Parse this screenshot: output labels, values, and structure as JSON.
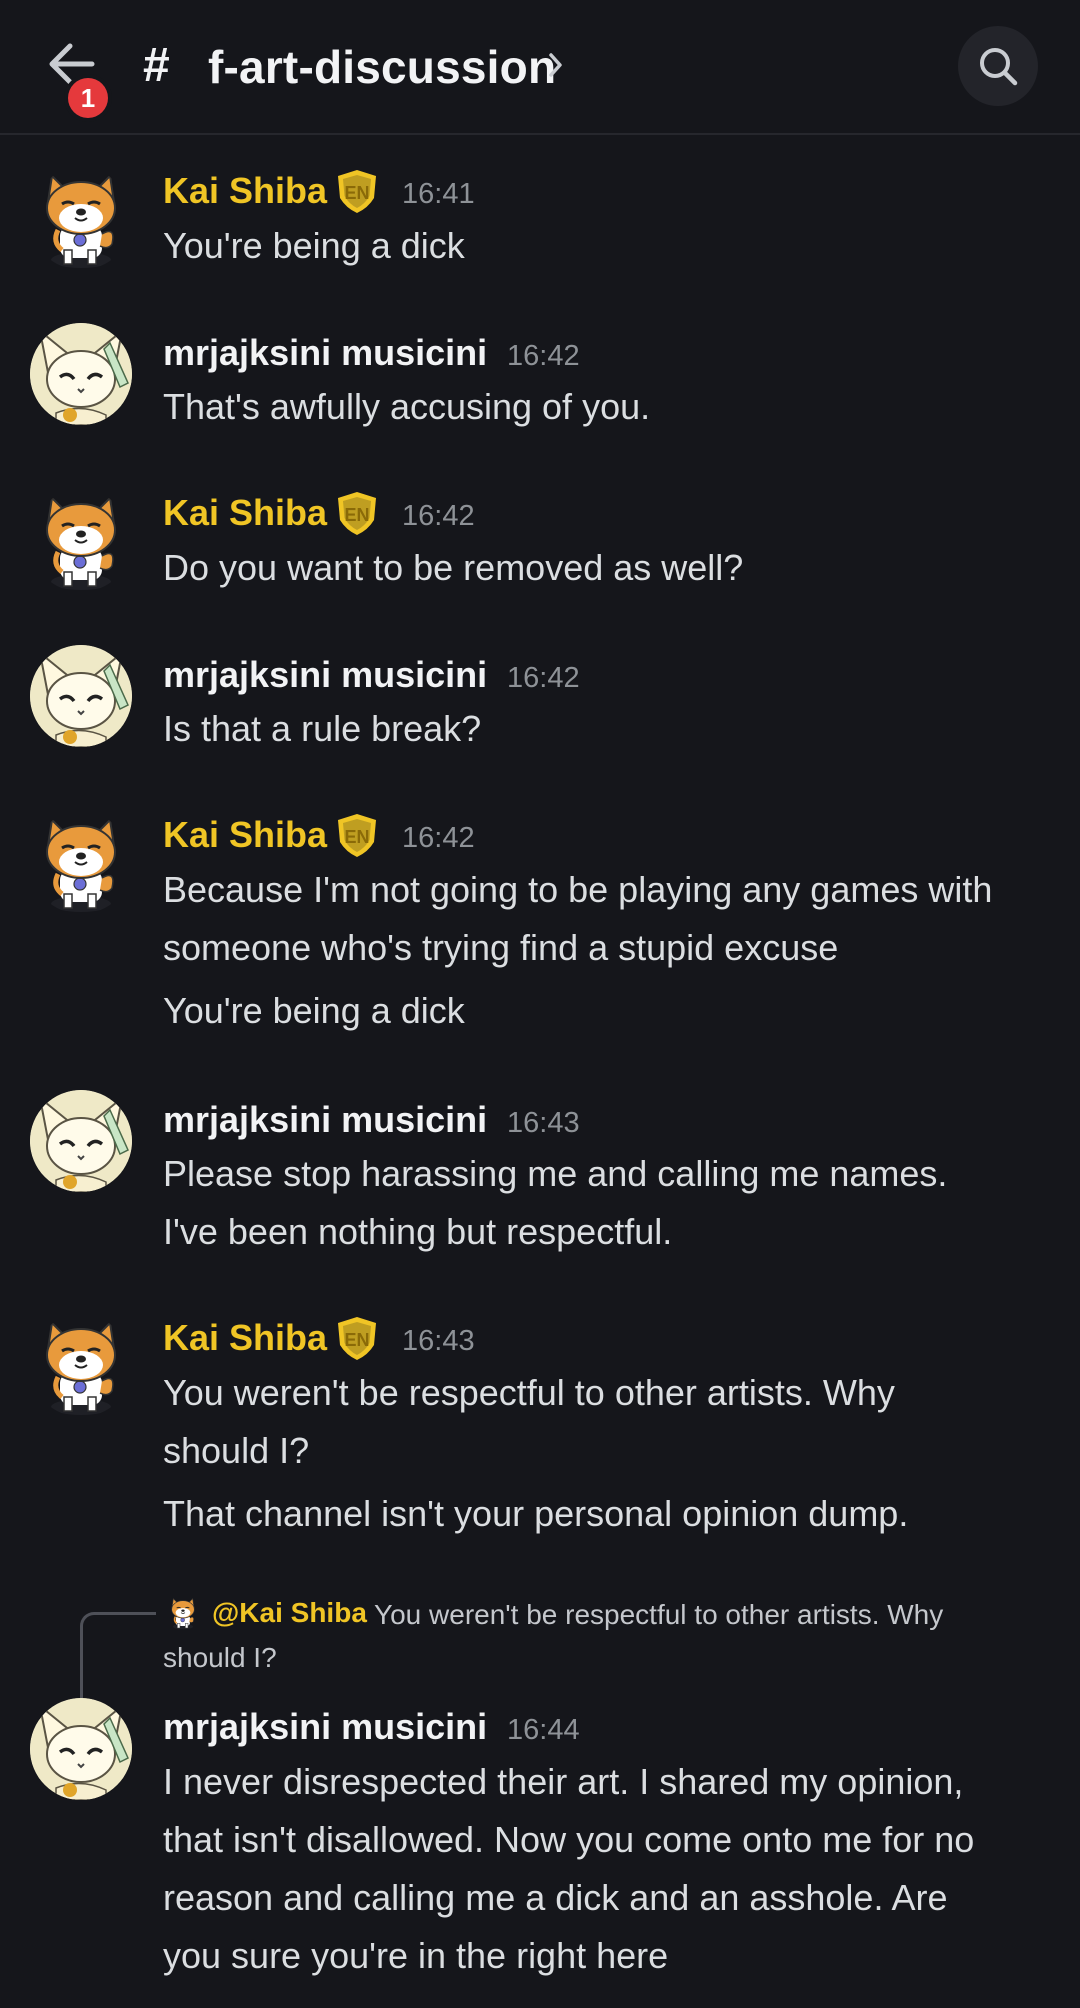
{
  "header": {
    "back_badge": "1",
    "hash": "#",
    "channel": "f-art-discussion"
  },
  "messages": [
    {
      "author": "Kai Shiba",
      "badge": "EN",
      "time": "16:41",
      "lines": [
        "You're being a dick"
      ]
    },
    {
      "author": "mrjajksini musicini",
      "time": "16:42",
      "lines": [
        "That's awfully accusing of you."
      ]
    },
    {
      "author": "Kai Shiba",
      "badge": "EN",
      "time": "16:42",
      "lines": [
        "Do you want to be removed as well?"
      ]
    },
    {
      "author": "mrjajksini musicini",
      "time": "16:42",
      "lines": [
        "Is that a rule break?"
      ]
    },
    {
      "author": "Kai Shiba",
      "badge": "EN",
      "time": "16:42",
      "lines": [
        "Because I'm not going to be playing any games with",
        "someone who's trying find a stupid excuse",
        "You're being a dick"
      ]
    },
    {
      "author": "mrjajksini musicini",
      "time": "16:43",
      "lines": [
        "Please stop harassing me and calling me names.",
        "I've been nothing but respectful."
      ]
    },
    {
      "author": "Kai Shiba",
      "badge": "EN",
      "time": "16:43",
      "lines": [
        "You weren't be respectful to other artists. Why",
        "should I?",
        "That channel isn't your personal opinion dump."
      ]
    },
    {
      "reply": {
        "mention": "@Kai Shiba",
        "text_line1": "You weren't be respectful to other artists. Why",
        "text_line2": "should I?"
      },
      "author": "mrjajksini musicini",
      "time": "16:44",
      "lines": [
        "I never disrespected their art. I shared my opinion,",
        "that isn't disallowed. Now you come onto me for no",
        "reason and calling me a dick and an asshole. Are",
        "you sure you're in the right here"
      ]
    }
  ],
  "colors": {
    "mod_name": "#f0c525",
    "user_name": "#f2f3f5",
    "background": "#15161b",
    "badge_red": "#e5393c"
  },
  "icons": {
    "back": "arrow-left-icon",
    "search": "search-icon",
    "chevron": "chevron-right-icon",
    "role": "shield-en-icon"
  }
}
